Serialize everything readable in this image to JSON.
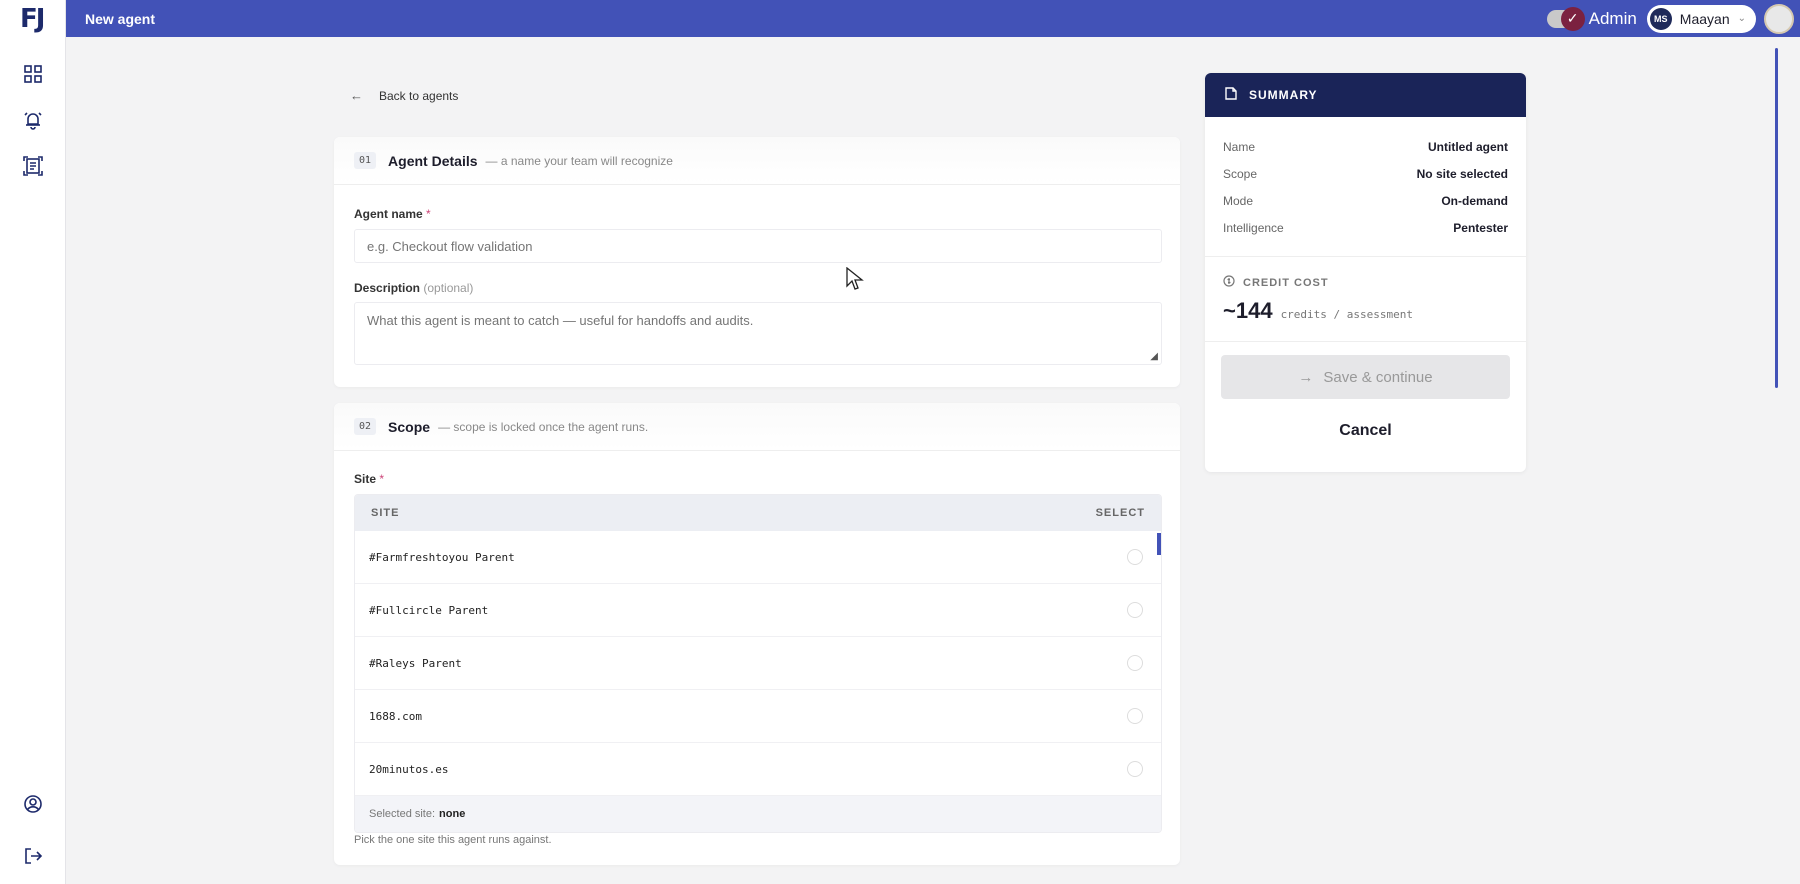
{
  "header": {
    "title": "New agent",
    "admin_label": "Admin",
    "user_initials": "MS",
    "user_name": "Maayan"
  },
  "sidebar": {
    "logo": "FJ"
  },
  "back_link": "Back to agents",
  "agent_details": {
    "number": "01",
    "title": "Agent Details",
    "hint": "— a name your team will recognize",
    "name_label": "Agent name",
    "required_mark": "*",
    "name_placeholder": "e.g. Checkout flow validation",
    "description_label": "Description",
    "optional_label": "(optional)",
    "description_placeholder": "What this agent is meant to catch — useful for handoffs and audits."
  },
  "scope": {
    "number": "02",
    "title": "Scope",
    "hint": "— scope is locked once the agent runs.",
    "site_label": "Site",
    "required_mark": "*",
    "table_header_site": "SITE",
    "table_header_select": "SELECT",
    "sites": [
      "#Farmfreshtoyou Parent",
      "#Fullcircle Parent",
      "#Raleys Parent",
      "1688.com",
      "20minutos.es"
    ],
    "selected_label": "Selected site:",
    "selected_value": "none",
    "help": "Pick the one site this agent runs against."
  },
  "summary": {
    "title": "SUMMARY",
    "rows": [
      {
        "key": "Name",
        "value": "Untitled agent"
      },
      {
        "key": "Scope",
        "value": "No site selected"
      },
      {
        "key": "Mode",
        "value": "On-demand"
      },
      {
        "key": "Intelligence",
        "value": "Pentester"
      }
    ],
    "credit_label": "CREDIT COST",
    "credit_value": "~144",
    "credit_unit": "credits / assessment",
    "save_label": "Save & continue",
    "cancel_label": "Cancel"
  },
  "colors": {
    "accent": "#4252b7",
    "summary_header": "#1a2458",
    "admin_toggle": "#7b2140"
  }
}
